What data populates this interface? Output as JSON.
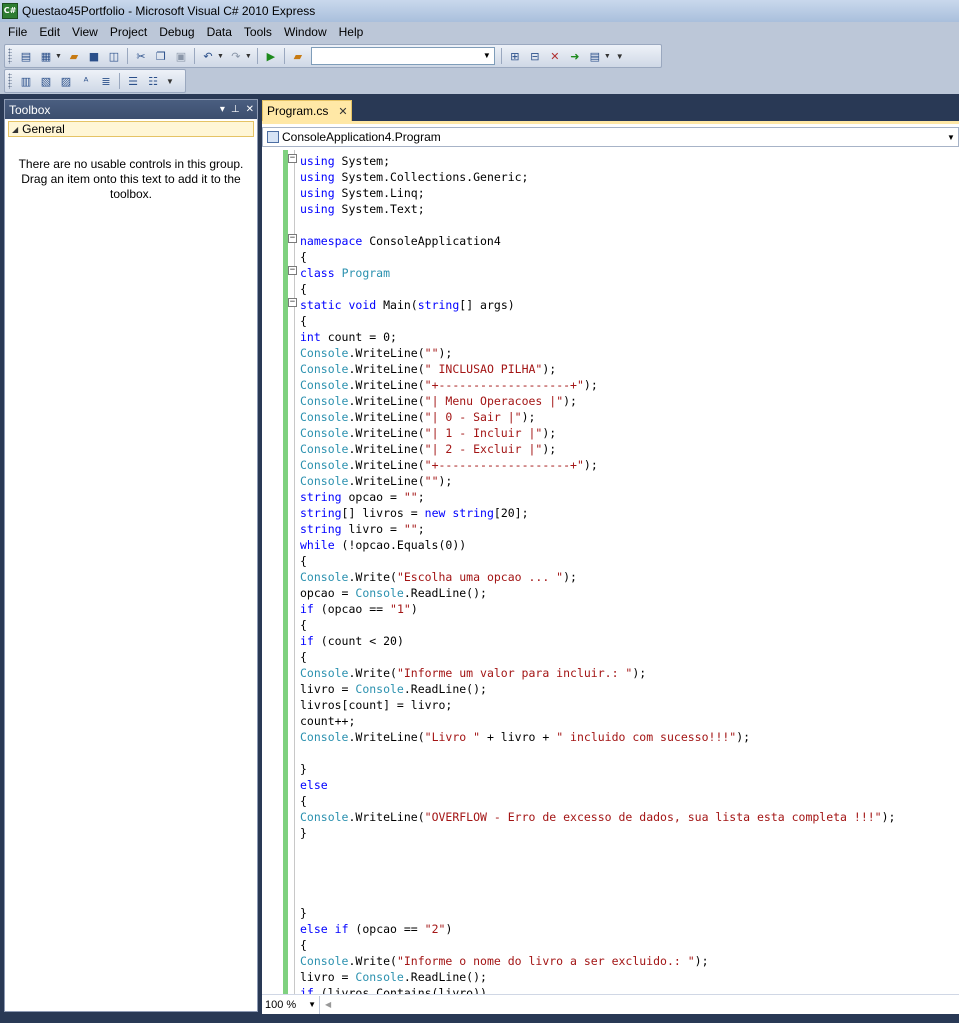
{
  "window": {
    "title": "Questao45Portfolio - Microsoft Visual C# 2010 Express"
  },
  "menu": [
    "File",
    "Edit",
    "View",
    "Project",
    "Debug",
    "Data",
    "Tools",
    "Window",
    "Help"
  ],
  "toolbox": {
    "title": "Toolbox",
    "group": "General",
    "empty_message": "There are no usable controls in this group. Drag an item onto this text to add it to the toolbox."
  },
  "editor": {
    "tab": "Program.cs",
    "navigator": "ConsoleApplication4.Program",
    "zoom": "100 %",
    "code_lines": [
      "using System;",
      "using System.Collections.Generic;",
      "using System.Linq;",
      "using System.Text;",
      "",
      "namespace ConsoleApplication4",
      "{",
      "class Program",
      "{",
      "static void Main(string[] args)",
      "{",
      "int count = 0;",
      "Console.WriteLine(\"\");",
      "Console.WriteLine(\" INCLUSAO PILHA\");",
      "Console.WriteLine(\"+-------------------+\");",
      "Console.WriteLine(\"| Menu Operacoes |\");",
      "Console.WriteLine(\"| 0 - Sair |\");",
      "Console.WriteLine(\"| 1 - Incluir |\");",
      "Console.WriteLine(\"| 2 - Excluir |\");",
      "Console.WriteLine(\"+-------------------+\");",
      "Console.WriteLine(\"\");",
      "string opcao = \"\";",
      "string[] livros = new string[20];",
      "string livro = \"\";",
      "while (!opcao.Equals(0))",
      "{",
      "Console.Write(\"Escolha uma opcao ... \");",
      "opcao = Console.ReadLine();",
      "if (opcao == \"1\")",
      "{",
      "if (count < 20)",
      "{",
      "Console.Write(\"Informe um valor para incluir.: \");",
      "livro = Console.ReadLine();",
      "livros[count] = livro;",
      "count++;",
      "Console.WriteLine(\"Livro \" + livro + \" incluido com sucesso!!!\");",
      "",
      "}",
      "else",
      "{",
      "Console.WriteLine(\"OVERFLOW - Erro de excesso de dados, sua lista esta completa !!!\");",
      "}",
      "",
      "",
      "",
      "",
      "}",
      "else if (opcao == \"2\")",
      "{",
      "Console.Write(\"Informe o nome do livro a ser excluido.: \");",
      "livro = Console.ReadLine();",
      "if (livros.Contains(livro))",
      "{"
    ]
  }
}
